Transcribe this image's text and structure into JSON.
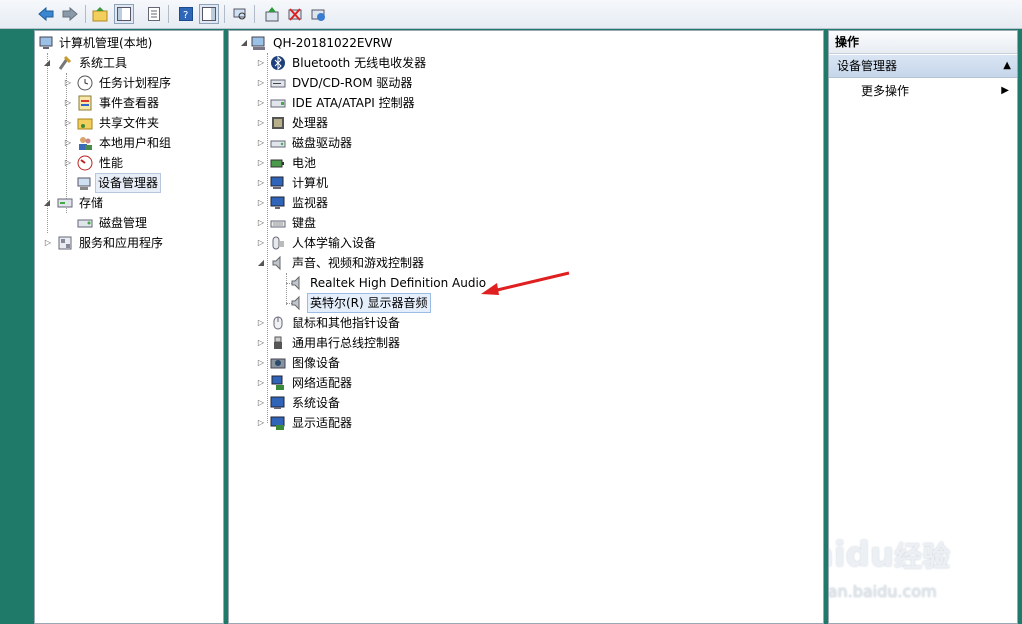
{
  "toolbar": {
    "buttons": [
      "back-icon",
      "forward-icon",
      "up-folder-icon",
      "show-hide-tree-icon",
      "properties-icon",
      "help-icon",
      "show-hide-action-pane-icon",
      "scan-hardware-icon",
      "update-driver-icon",
      "disable-device-icon",
      "uninstall-device-icon"
    ]
  },
  "nav_tree": {
    "root": "计算机管理(本地)",
    "system_tools": "系统工具",
    "task_scheduler": "任务计划程序",
    "event_viewer": "事件查看器",
    "shared_folders": "共享文件夹",
    "local_users": "本地用户和组",
    "performance": "性能",
    "device_manager": "设备管理器",
    "storage": "存储",
    "disk_management": "磁盘管理",
    "services_apps": "服务和应用程序"
  },
  "device_tree": {
    "computer_name": "QH-20181022EVRW",
    "categories": [
      {
        "label": "Bluetooth 无线电收发器",
        "icon": "bluetooth-icon"
      },
      {
        "label": "DVD/CD-ROM 驱动器",
        "icon": "dvd-drive-icon"
      },
      {
        "label": "IDE ATA/ATAPI 控制器",
        "icon": "ide-controller-icon"
      },
      {
        "label": "处理器",
        "icon": "processor-icon"
      },
      {
        "label": "磁盘驱动器",
        "icon": "disk-drive-icon"
      },
      {
        "label": "电池",
        "icon": "battery-icon"
      },
      {
        "label": "计算机",
        "icon": "computer-icon"
      },
      {
        "label": "监视器",
        "icon": "monitor-icon"
      },
      {
        "label": "键盘",
        "icon": "keyboard-icon"
      },
      {
        "label": "人体学输入设备",
        "icon": "hid-icon"
      },
      {
        "label": "声音、视频和游戏控制器",
        "icon": "speaker-icon"
      },
      {
        "label": "鼠标和其他指针设备",
        "icon": "mouse-icon"
      },
      {
        "label": "通用串行总线控制器",
        "icon": "usb-icon"
      },
      {
        "label": "图像设备",
        "icon": "camera-icon"
      },
      {
        "label": "网络适配器",
        "icon": "network-adapter-icon"
      },
      {
        "label": "系统设备",
        "icon": "system-device-icon"
      },
      {
        "label": "显示适配器",
        "icon": "display-adapter-icon"
      }
    ],
    "sound_children": [
      "Realtek High Definition Audio",
      "英特尔(R) 显示器音频"
    ]
  },
  "action_pane": {
    "header": "操作",
    "section": "设备管理器",
    "more_actions": "更多操作"
  },
  "watermark": {
    "brand_a": "Bai",
    "brand_b": "du",
    "brand_c": "经验",
    "url": "jingyan.baidu.com"
  },
  "colors": {
    "background": "#1f7a6a",
    "annotation_arrow": "#e02020",
    "selection": "#e5eefb"
  }
}
